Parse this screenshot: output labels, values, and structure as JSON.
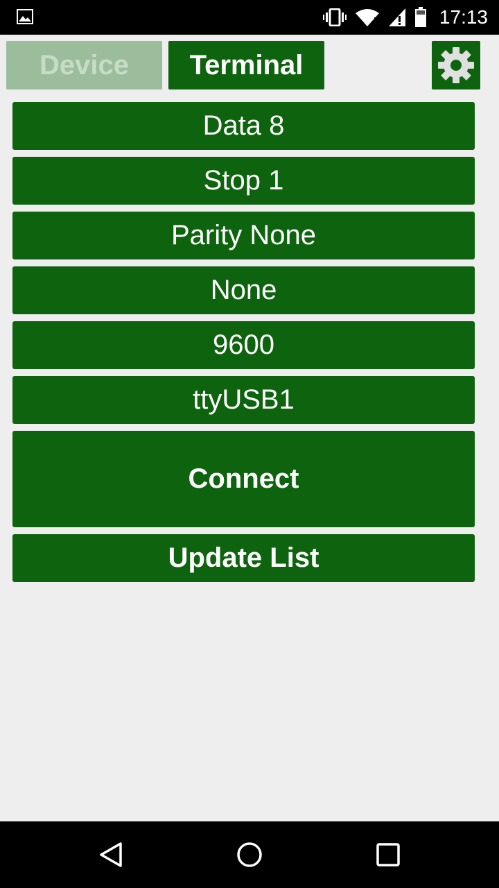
{
  "status_bar": {
    "time": "17:13",
    "icons": [
      "image-notification-icon",
      "vibrate-icon",
      "wifi-icon",
      "signal-icon",
      "battery-icon"
    ]
  },
  "tabs": {
    "device_label": "Device",
    "terminal_label": "Terminal",
    "settings_icon": "gear-icon"
  },
  "settings": {
    "data_bits": "Data 8",
    "stop_bits": "Stop 1",
    "parity": "Parity None",
    "flow_control": "None",
    "baud_rate": "9600",
    "port": "ttyUSB1"
  },
  "actions": {
    "connect_label": "Connect",
    "update_list_label": "Update List"
  },
  "colors": {
    "primary_green": "#0e640e",
    "disabled_green": "#9bbd9b",
    "background": "#eeeeee"
  },
  "nav_bar": {
    "icons": [
      "back-icon",
      "home-icon",
      "recent-apps-icon"
    ]
  }
}
